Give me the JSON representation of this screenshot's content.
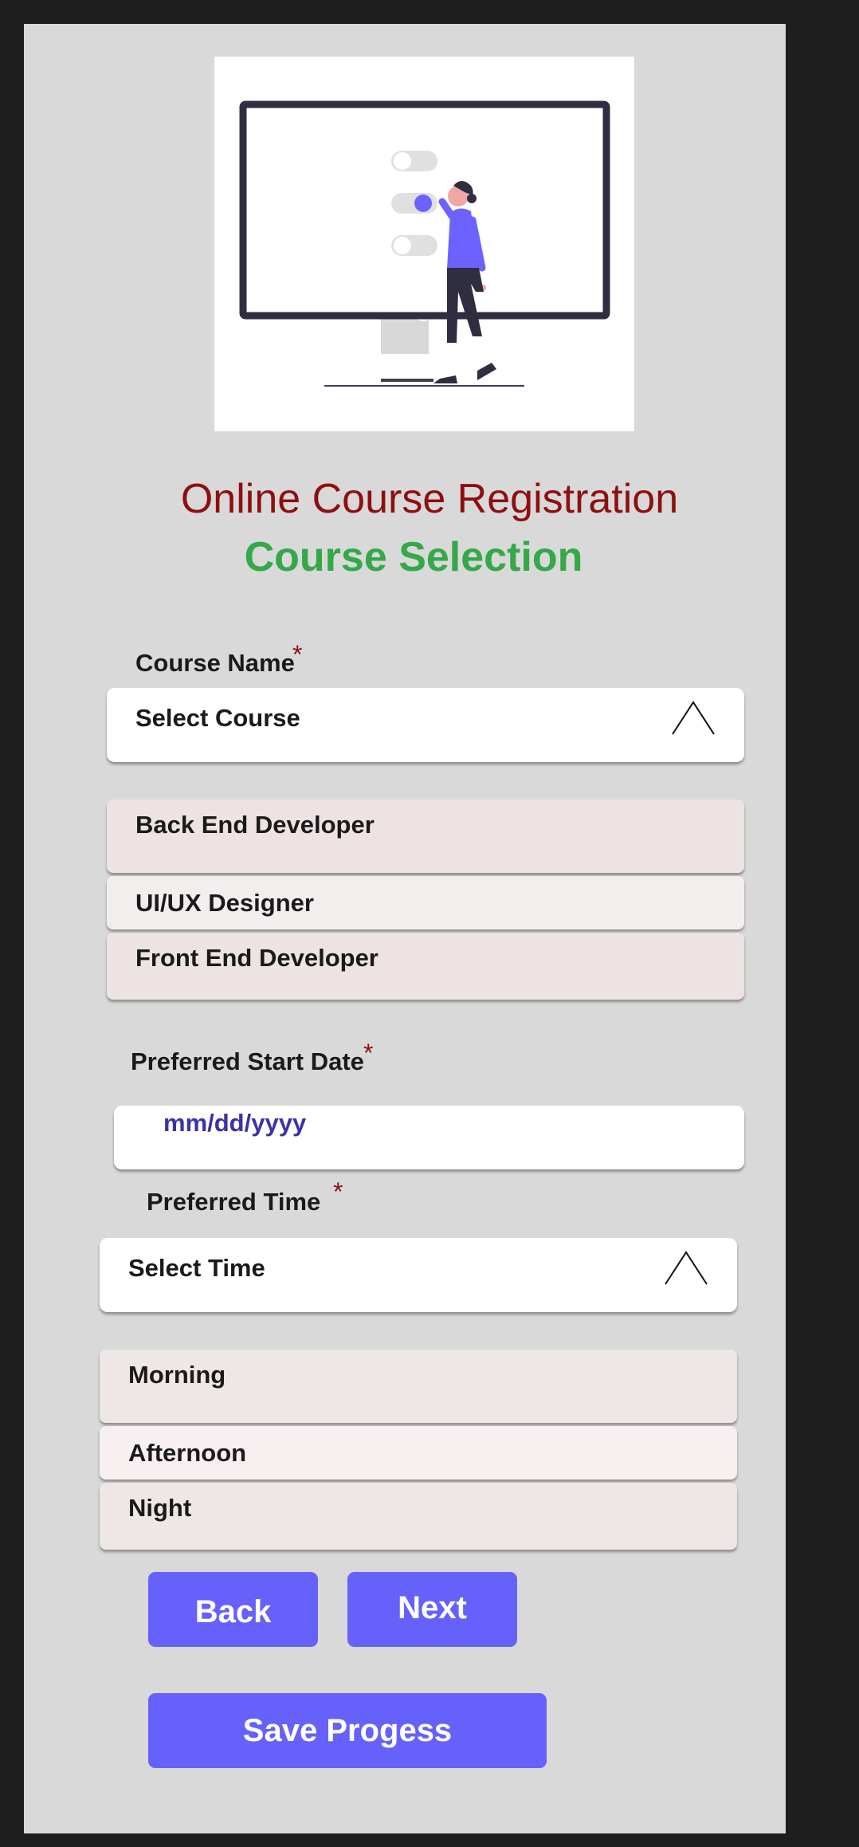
{
  "header": {
    "title": "Online Course Registration",
    "subtitle": "Course Selection"
  },
  "course": {
    "label": "Course Name",
    "required_mark": "*",
    "placeholder": "Select Course",
    "options": [
      "Back End Developer",
      "UI/UX Designer",
      "Front End Developer"
    ]
  },
  "start_date": {
    "label": "Preferred Start Date",
    "required_mark": "*",
    "placeholder": "mm/dd/yyyy"
  },
  "time": {
    "label": "Preferred Time",
    "required_mark": "*",
    "placeholder": "Select Time",
    "options": [
      "Morning",
      "Afternoon",
      "Night"
    ]
  },
  "actions": {
    "back_label": "Back",
    "next_label": "Next",
    "save_label": "Save Progess"
  },
  "colors": {
    "title": "#8e0f0f",
    "subtitle": "#35a84a",
    "accent": "#6561fa",
    "date_placeholder": "#3a33a7"
  },
  "icons": {
    "illustration": "person-at-monitor-illustration",
    "caret": "chevron-up-icon"
  }
}
